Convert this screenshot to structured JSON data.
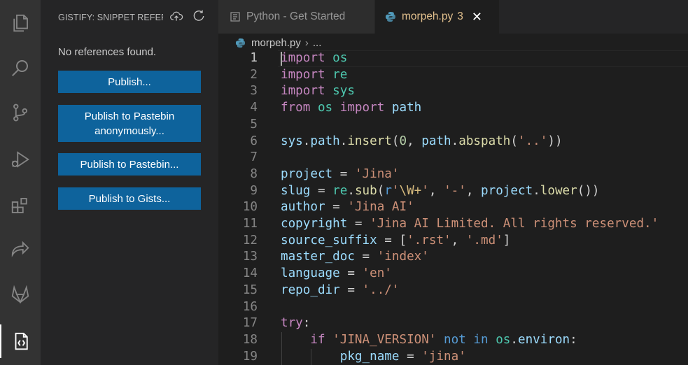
{
  "activity_bar": {
    "items": [
      {
        "icon": "files-icon"
      },
      {
        "icon": "search-icon"
      },
      {
        "icon": "source-control-icon"
      },
      {
        "icon": "run-debug-icon"
      },
      {
        "icon": "extensions-icon"
      },
      {
        "icon": "live-share-icon"
      },
      {
        "icon": "gitlab-icon"
      },
      {
        "icon": "gistify-icon"
      }
    ]
  },
  "sidebar": {
    "title": "GISTIFY: SNIPPET REFERENCES",
    "message": "No references found.",
    "buttons": [
      {
        "label": "Publish..."
      },
      {
        "label": "Publish to Pastebin anonymously..."
      },
      {
        "label": "Publish to Pastebin..."
      },
      {
        "label": "Publish to Gists..."
      }
    ]
  },
  "tabs": [
    {
      "label": "Python - Get Started",
      "active": false
    },
    {
      "label": "morpeh.py",
      "badge": "3",
      "active": true
    }
  ],
  "breadcrumb": {
    "file": "morpeh.py",
    "more": "..."
  },
  "editor": {
    "current_line": 1,
    "lines": [
      {
        "n": "1",
        "tokens": [
          [
            "kw",
            "import"
          ],
          [
            "op",
            " "
          ],
          [
            "mod",
            "os"
          ]
        ]
      },
      {
        "n": "2",
        "tokens": [
          [
            "kw",
            "import"
          ],
          [
            "op",
            " "
          ],
          [
            "mod",
            "re"
          ]
        ]
      },
      {
        "n": "3",
        "tokens": [
          [
            "kw",
            "import"
          ],
          [
            "op",
            " "
          ],
          [
            "mod",
            "sys"
          ]
        ]
      },
      {
        "n": "4",
        "tokens": [
          [
            "kw",
            "from"
          ],
          [
            "op",
            " "
          ],
          [
            "mod",
            "os"
          ],
          [
            "op",
            " "
          ],
          [
            "kw",
            "import"
          ],
          [
            "op",
            " "
          ],
          [
            "var",
            "path"
          ]
        ]
      },
      {
        "n": "5",
        "tokens": []
      },
      {
        "n": "6",
        "tokens": [
          [
            "var",
            "sys"
          ],
          [
            "op",
            "."
          ],
          [
            "var",
            "path"
          ],
          [
            "op",
            "."
          ],
          [
            "fn",
            "insert"
          ],
          [
            "op",
            "("
          ],
          [
            "num",
            "0"
          ],
          [
            "op",
            ", "
          ],
          [
            "var",
            "path"
          ],
          [
            "op",
            "."
          ],
          [
            "fn",
            "abspath"
          ],
          [
            "op",
            "("
          ],
          [
            "str",
            "'..'"
          ],
          [
            "op",
            "))"
          ]
        ]
      },
      {
        "n": "7",
        "tokens": []
      },
      {
        "n": "8",
        "tokens": [
          [
            "var",
            "project"
          ],
          [
            "op",
            " = "
          ],
          [
            "str",
            "'Jina'"
          ]
        ]
      },
      {
        "n": "9",
        "tokens": [
          [
            "var",
            "slug"
          ],
          [
            "op",
            " = "
          ],
          [
            "mod",
            "re"
          ],
          [
            "op",
            "."
          ],
          [
            "fn",
            "sub"
          ],
          [
            "op",
            "("
          ],
          [
            "kwb",
            "r"
          ],
          [
            "str",
            "'"
          ],
          [
            "esc",
            "\\W+"
          ],
          [
            "str",
            "'"
          ],
          [
            "op",
            ", "
          ],
          [
            "str",
            "'-'"
          ],
          [
            "op",
            ", "
          ],
          [
            "var",
            "project"
          ],
          [
            "op",
            "."
          ],
          [
            "fn",
            "lower"
          ],
          [
            "op",
            "())"
          ]
        ]
      },
      {
        "n": "10",
        "tokens": [
          [
            "var",
            "author"
          ],
          [
            "op",
            " = "
          ],
          [
            "str",
            "'Jina AI'"
          ]
        ]
      },
      {
        "n": "11",
        "tokens": [
          [
            "var",
            "copyright"
          ],
          [
            "op",
            " = "
          ],
          [
            "str",
            "'Jina AI Limited. All rights reserved.'"
          ]
        ]
      },
      {
        "n": "12",
        "tokens": [
          [
            "var",
            "source_suffix"
          ],
          [
            "op",
            " = ["
          ],
          [
            "str",
            "'.rst'"
          ],
          [
            "op",
            ", "
          ],
          [
            "str",
            "'.md'"
          ],
          [
            "op",
            "]"
          ]
        ]
      },
      {
        "n": "13",
        "tokens": [
          [
            "var",
            "master_doc"
          ],
          [
            "op",
            " = "
          ],
          [
            "str",
            "'index'"
          ]
        ]
      },
      {
        "n": "14",
        "tokens": [
          [
            "var",
            "language"
          ],
          [
            "op",
            " = "
          ],
          [
            "str",
            "'en'"
          ]
        ]
      },
      {
        "n": "15",
        "tokens": [
          [
            "var",
            "repo_dir"
          ],
          [
            "op",
            " = "
          ],
          [
            "str",
            "'../'"
          ]
        ]
      },
      {
        "n": "16",
        "tokens": []
      },
      {
        "n": "17",
        "tokens": [
          [
            "kw",
            "try"
          ],
          [
            "op",
            ":"
          ]
        ]
      },
      {
        "n": "18",
        "tokens": [
          [
            "op",
            "    "
          ],
          [
            "kw",
            "if"
          ],
          [
            "op",
            " "
          ],
          [
            "str",
            "'JINA_VERSION'"
          ],
          [
            "op",
            " "
          ],
          [
            "kwb",
            "not"
          ],
          [
            "op",
            " "
          ],
          [
            "kwb",
            "in"
          ],
          [
            "op",
            " "
          ],
          [
            "mod",
            "os"
          ],
          [
            "op",
            "."
          ],
          [
            "var",
            "environ"
          ],
          [
            "op",
            ":"
          ]
        ]
      },
      {
        "n": "19",
        "tokens": [
          [
            "op",
            "        "
          ],
          [
            "var",
            "pkg_name"
          ],
          [
            "op",
            " = "
          ],
          [
            "str",
            "'jina'"
          ]
        ]
      }
    ]
  },
  "colors": {
    "accent_button": "#0e639c",
    "tab_modified": "#e2c08d",
    "editor_bg": "#1e1e1e",
    "sidebar_bg": "#252526",
    "activity_bg": "#333333"
  }
}
